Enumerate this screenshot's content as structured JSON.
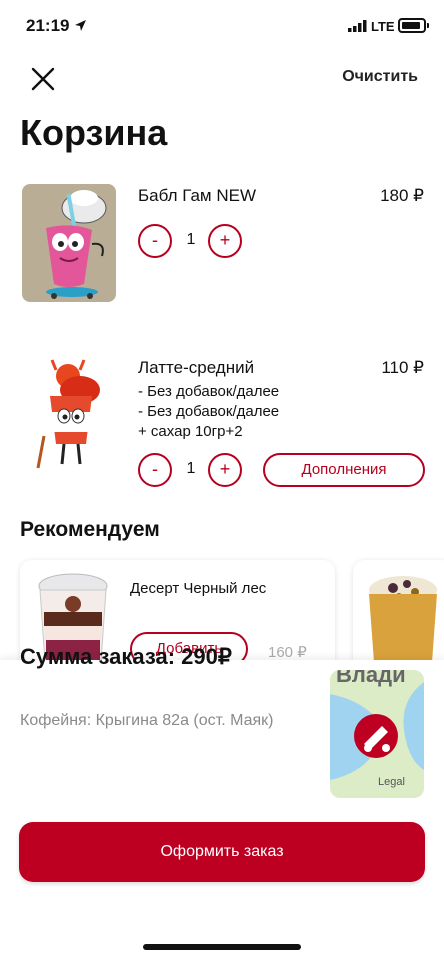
{
  "status_bar": {
    "time": "21:19",
    "network": "LTE"
  },
  "header": {
    "clear_label": "Очистить",
    "title": "Корзина"
  },
  "cart": {
    "items": [
      {
        "name": "Бабл Гам NEW",
        "price": "180 ₽",
        "quantity": "1",
        "modifiers": []
      },
      {
        "name": "Латте-средний",
        "price": "110 ₽",
        "quantity": "1",
        "modifiers": [
          "- Без добавок/далее",
          "- Без добавок/далее",
          "+ сахар 10гр+2"
        ],
        "addons_label": "Дополнения"
      }
    ],
    "minus_label": "-",
    "plus_label": "+"
  },
  "recommendations": {
    "title": "Рекомендуем",
    "items": [
      {
        "name": "Десерт Черный лес",
        "add_label": "Добавить",
        "price": "160 ₽"
      }
    ]
  },
  "summary": {
    "total_label": "Сумма заказа: 290₽",
    "cafe": "Кофейня: Крыгина 82а (ост. Маяк)",
    "map_label": "Влади",
    "map_legal": "Legal",
    "checkout_label": "Оформить заказ"
  },
  "colors": {
    "accent": "#bd0022",
    "muted": "#8a8a8a"
  }
}
